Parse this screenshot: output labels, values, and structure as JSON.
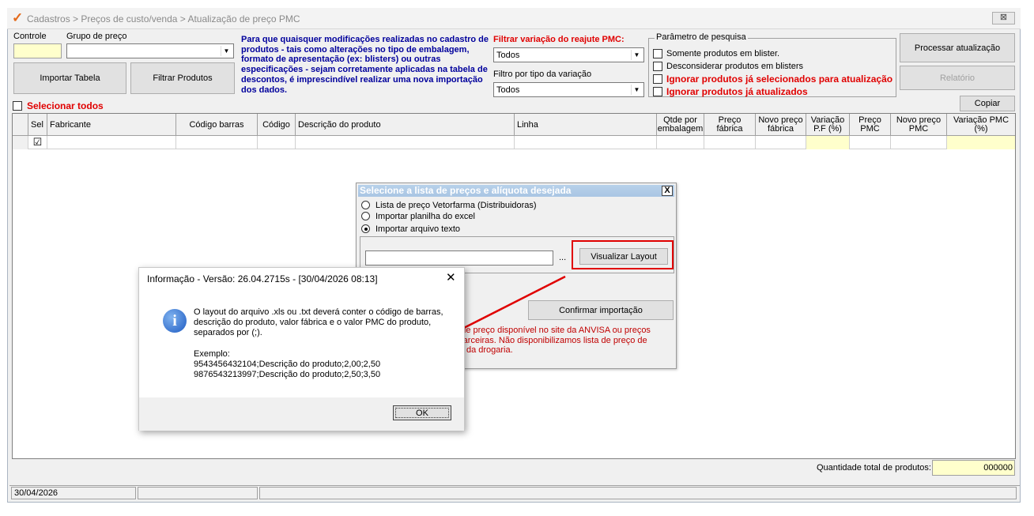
{
  "window": {
    "breadcrumb": "Cadastros > Preços de custo/venda > Atualização de preço PMC",
    "close_glyph": "⊠"
  },
  "top": {
    "controle_label": "Controle",
    "grupo_label": "Grupo de preço",
    "import_button": "Importar Tabela",
    "filter_button": "Filtrar Produtos",
    "info_text": "Para que quaisquer modificações realizadas no cadastro de produtos - tais como alterações no tipo de embalagem, formato de apresentação (ex: blisters) ou outras especificações - sejam corretamente aplicadas na tabela de descontos, é imprescindível realizar uma nova importação dos dados.",
    "filter_pmc_label": "Filtrar variação do reajute PMC:",
    "filter_pmc_value": "Todos",
    "filter_tipo_label": "Filtro por tipo da variação",
    "filter_tipo_value": "Todos",
    "params_legend": "Parâmetro de pesquisa",
    "params": [
      {
        "label": "Somente produtos em blister.",
        "red": false
      },
      {
        "label": "Desconsiderar produtos em blisters",
        "red": false
      },
      {
        "label": "Ignorar produtos já selecionados para atualização",
        "red": true
      },
      {
        "label": "Ignorar produtos já atualizados",
        "red": true
      }
    ],
    "process_button": "Processar atualização",
    "report_button": "Relatório",
    "copy_button": "Copiar",
    "select_all_label": "Selecionar todos"
  },
  "grid": {
    "columns": [
      "Sel",
      "Fabricante",
      "Código barras",
      "Código",
      "Descrição do produto",
      "Linha",
      "Qtde por embalagem",
      "Preço fábrica",
      "Novo preço fábrica",
      "Variação P.F (%)",
      "Preço PMC",
      "Novo preço PMC",
      "Variação PMC (%)"
    ],
    "row_checked": "☑"
  },
  "bottom": {
    "total_label": "Quantidade total de produtos:",
    "total_value": "000000",
    "status_date": "30/04/2026"
  },
  "import_dialog": {
    "title": "Selecione a lista de preços e alíquota desejada",
    "close": "X",
    "options": [
      "Lista de preço Vetorfarma (Distribuidoras)",
      "Importar planilha do excel",
      "Importar arquivo texto"
    ],
    "selected_option": 2,
    "browse": "...",
    "layout_button": "Visualizar Layout",
    "confirm_button": "Confirmar importação",
    "note_lines": [
      "ta de preço disponível no site da ANVISA ou preços",
      "s parceiras. Não disponibilizamos lista de preço de",
      "ura da drogaria."
    ]
  },
  "message_box": {
    "title": "Informação - Versão: 26.04.2715s - [30/04/2026 08:13]",
    "close": "✕",
    "text": "O layout do arquivo .xls ou .txt deverá conter o código de barras, descrição do produto, valor fábrica e o valor PMC do produto, separados por (;).",
    "example_label": "Exemplo:",
    "example_lines": [
      "9543456432104;Descrição do produto;2,00;2,50",
      "9876543213997;Descrição do produto;2,50;3,50"
    ],
    "ok_button": "OK"
  },
  "colors": {
    "accent_red": "#e00000",
    "info_blue": "#00009c",
    "highlight_yellow": "#ffffcc"
  }
}
